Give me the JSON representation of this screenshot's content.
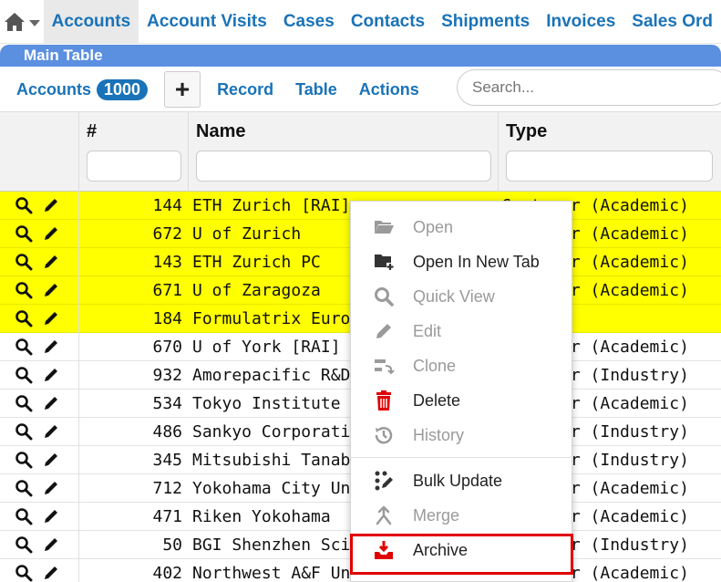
{
  "nav": {
    "tabs": [
      {
        "label": "Accounts",
        "active": true
      },
      {
        "label": "Account Visits",
        "active": false
      },
      {
        "label": "Cases",
        "active": false
      },
      {
        "label": "Contacts",
        "active": false
      },
      {
        "label": "Shipments",
        "active": false
      },
      {
        "label": "Invoices",
        "active": false
      },
      {
        "label": "Sales Ord",
        "active": false
      }
    ]
  },
  "main_table": {
    "title": "Main Table"
  },
  "toolbar": {
    "accounts_label": "Accounts",
    "count": "1000",
    "add_label": "+",
    "record_label": "Record",
    "table_label": "Table",
    "actions_label": "Actions",
    "search_placeholder": "Search..."
  },
  "columns": {
    "num": "#",
    "name": "Name",
    "type": "Type"
  },
  "rows": [
    {
      "num": "144",
      "name": "ETH Zurich [RAI]",
      "type": "Customer (Academic)",
      "highlight": true
    },
    {
      "num": "672",
      "name": "U of Zurich",
      "type": "Customer (Academic)",
      "highlight": true
    },
    {
      "num": "143",
      "name": "ETH Zurich PC",
      "type": "Customer (Academic)",
      "highlight": true
    },
    {
      "num": "671",
      "name": "U of Zaragoza",
      "type": "Customer (Academic)",
      "highlight": true
    },
    {
      "num": "184",
      "name": "Formulatrix Europe",
      "type": "",
      "highlight": true
    },
    {
      "num": "670",
      "name": "U of York [RAI]",
      "type": "Customer (Academic)",
      "highlight": false
    },
    {
      "num": "932",
      "name": "Amorepacific R&D",
      "type": "Customer (Industry)",
      "highlight": false
    },
    {
      "num": "534",
      "name": "Tokyo Institute of",
      "type": "Customer (Academic)",
      "highlight": false
    },
    {
      "num": "486",
      "name": "Sankyo Corporation",
      "type": "Customer (Industry)",
      "highlight": false
    },
    {
      "num": "345",
      "name": "Mitsubishi Tanabe",
      "type": "Customer (Industry)",
      "highlight": false
    },
    {
      "num": "712",
      "name": "Yokohama City Uni",
      "type": "Customer (Academic)",
      "highlight": false
    },
    {
      "num": "471",
      "name": "Riken Yokohama",
      "type": "Customer (Academic)",
      "highlight": false
    },
    {
      "num": "50",
      "name": "BGI Shenzhen Sci",
      "type": "Customer (Industry)",
      "highlight": false
    },
    {
      "num": "402",
      "name": "Northwest A&F University",
      "type": "Customer (Academic)",
      "highlight": false
    }
  ],
  "context_menu": {
    "items": [
      {
        "label": "Open",
        "icon": "folder-open-icon",
        "enabled": false
      },
      {
        "label": "Open In New Tab",
        "icon": "folder-plus-icon",
        "enabled": true
      },
      {
        "label": "Quick View",
        "icon": "search-icon",
        "enabled": false
      },
      {
        "label": "Edit",
        "icon": "pencil-icon",
        "enabled": false
      },
      {
        "label": "Clone",
        "icon": "clone-icon",
        "enabled": false
      },
      {
        "label": "Delete",
        "icon": "trash-icon",
        "enabled": true
      },
      {
        "label": "History",
        "icon": "history-icon",
        "enabled": false
      },
      {
        "label": "Bulk Update",
        "icon": "bulk-update-icon",
        "enabled": true
      },
      {
        "label": "Merge",
        "icon": "merge-icon",
        "enabled": false
      },
      {
        "label": "Archive",
        "icon": "archive-icon",
        "enabled": true
      }
    ]
  },
  "colors": {
    "link": "#1a73b8",
    "highlight": "#ffff00",
    "main_bar": "#5b8fe0",
    "delete": "#e00000",
    "archive_box": "#e00000"
  }
}
